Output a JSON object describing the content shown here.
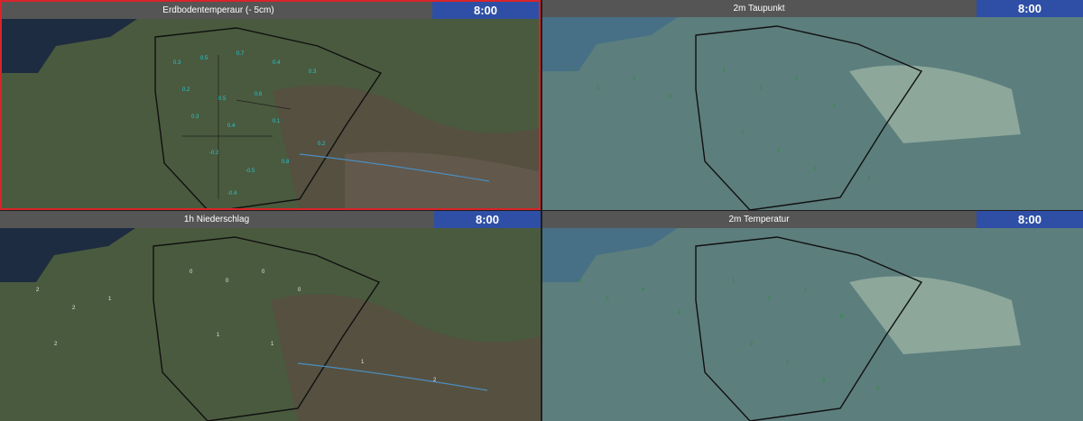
{
  "colors": {
    "time_badge": "#2e4fa5",
    "title_bar": "#555555",
    "active_border": "#d8242a",
    "soil_values": "#28c8d8",
    "dew_values": "#2f8a3a",
    "temp_values": "#2f8a3a",
    "rain_values": "#e8e8e8"
  },
  "panels": [
    {
      "title": "Erdbodentemperaur (- 5cm)",
      "time": "8:00",
      "overlay": "none",
      "value_style": "cyan"
    },
    {
      "title": "2m Taupunkt",
      "time": "8:00",
      "overlay": "blue-translucent",
      "value_style": "green"
    },
    {
      "title": "1h Niederschlag",
      "time": "8:00",
      "overlay": "none",
      "value_style": "white"
    },
    {
      "title": "2m Temperatur",
      "time": "8:00",
      "overlay": "blue-translucent",
      "value_style": "green"
    }
  ]
}
